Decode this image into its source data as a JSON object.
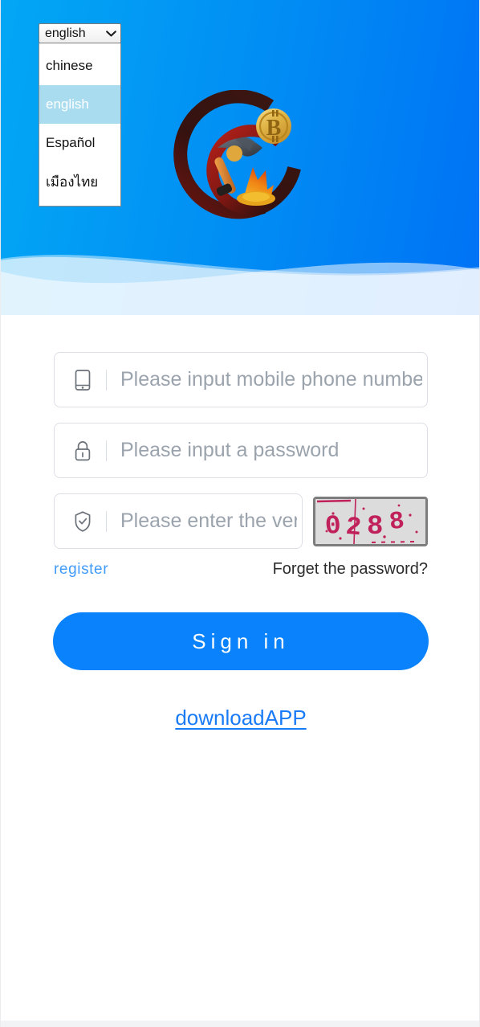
{
  "theme": {
    "header_gradient_from": "#02a7f5",
    "header_gradient_to": "#0072f5",
    "wave_pale": "#daeefb",
    "wave_mid": "#7fbdf7",
    "accent_blue": "#0a82fb",
    "link_blue": "#1a7bf7",
    "register_blue": "#419bf9",
    "captcha_text": "#c0215a",
    "captcha_bg": "#dcdcdc",
    "logo_arc_dark": "#3a1512",
    "logo_arc_red": "#a61f17",
    "logo_coin": "#e6b844"
  },
  "language_selector": {
    "name": "language-select",
    "selected": "english",
    "expanded": true,
    "chevron_icon": "chevron-down-icon",
    "options": [
      {
        "value": "chinese",
        "label": "chinese",
        "selected": false
      },
      {
        "value": "english",
        "label": "english",
        "selected": true
      },
      {
        "value": "spanish",
        "label": "Español",
        "selected": false
      },
      {
        "value": "thai",
        "label": "เมืองไทย",
        "selected": false
      }
    ]
  },
  "logo": {
    "name": "app-logo",
    "description": "circular arc logo with bitcoin coin and mining pickaxe",
    "coin_symbol": "₿"
  },
  "form": {
    "phone": {
      "icon": "mobile-phone-icon",
      "placeholder": "Please input mobile phone number",
      "value": ""
    },
    "password": {
      "icon": "lock-icon",
      "placeholder": "Please input a password",
      "value": ""
    },
    "verification": {
      "icon": "shield-check-icon",
      "placeholder": "Please enter the verification code",
      "value": ""
    },
    "captcha": {
      "name": "captcha-image",
      "code": "0288"
    },
    "register_label": "register",
    "forgot_label": "Forget the password?",
    "submit_label": "Sign in",
    "download_label": "downloadAPP"
  }
}
